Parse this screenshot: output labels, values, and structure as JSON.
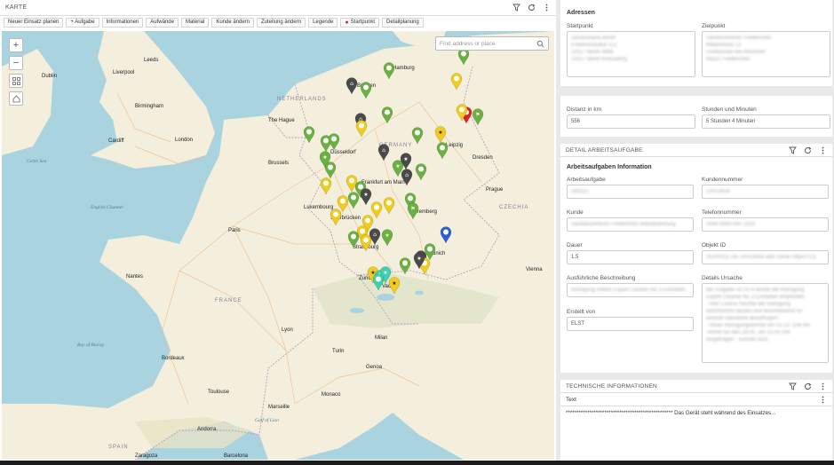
{
  "map_panel": {
    "title": "KARTE",
    "toolbar": [
      "Neuer Einsatz planen",
      "+ Aufgabe",
      "Informationen",
      "Aufwände",
      "Material",
      "Kunde ändern",
      "Zuteilung ändern",
      "Legende",
      "Startpunkt",
      "Detailplanung"
    ],
    "search_placeholder": "Find address or place",
    "cities": [
      "Dublin",
      "Leeds",
      "Liverpool",
      "Birmingham",
      "Cardiff",
      "London",
      "Hamburg",
      "Bremen",
      "The Hague",
      "Düsseldorf",
      "Dresden",
      "Brussels",
      "Frankfurt am Main",
      "Luxembourg",
      "Saarbrücken",
      "Nuremberg",
      "Prague",
      "Paris",
      "Strasbourg",
      "Munich",
      "Vienna",
      "Zurich",
      "Vaduz",
      "Nantes",
      "Lyon",
      "Milan",
      "Turin",
      "Genoa",
      "Bordeaux",
      "Toulouse",
      "Marseille",
      "Monaco",
      "Barcelona",
      "Andorra",
      "Zaragoza",
      "Leipzig"
    ],
    "countries": [
      "NETHERLANDS",
      "GERMANY",
      "CZECHIA",
      "FRANCE",
      "SPAIN"
    ],
    "seas": [
      "Celtic Sea",
      "English Channel",
      "Bay of Biscay",
      "Gulf of Lion"
    ]
  },
  "addresses": {
    "title": "Adressen",
    "start_label": "Startpunkt",
    "start_lines": [
      "Deutschland Berlin",
      "Friedrichstraße 112",
      "10117 Berlin Mitte",
      "10117 Berlin-Kreuzberg"
    ],
    "target_label": "Zielpunkt",
    "target_lines": [
      "Sanitärzentrum Feldkirchen",
      "Mittelstraße 12",
      "Feldkirchen bei München",
      "85622 Feldkirchen"
    ],
    "distance_label": "Distanz in km",
    "distance_value": "556",
    "duration_label": "Stunden und Minuten",
    "duration_value": "5 Stunden 4 Minuten"
  },
  "detail": {
    "header": "DETAIL ARBEITSAUFGABE",
    "title": "Arbeitsaufgaben Information",
    "fields": {
      "task_label": "Arbeitsaufgabe",
      "task_value": "389321",
      "customer_no_label": "Kundennummer",
      "customer_no_value": "10023458",
      "customer_label": "Kunde",
      "customer_value": "Sanitätszentrum Feldkirchen Betriebsleitung",
      "phone_label": "Telefonnummer",
      "phone_value": "0049 8963 000 2333",
      "duration_label": "Dauer",
      "duration_value": "1.5",
      "object_label": "Objekt ID",
      "object_value": "SERVICE-DE-10023458 with Serial Object CS",
      "desc_label": "Ausführliche Beschreibung",
      "desc_value": "Reinigung mittels Expert Cleaner bis 3 Einheiten",
      "reason_label": "Details Ursache",
      "reason_lines": [
        "Bei Aufgabe 327474 wurde die Reinigung",
        "Expert Cleaner bis 3 Einheiten empfohlen.",
        "- Herr Lorenz möchte die Reinigung",
        "durchführen lassen und anschließend für",
        "weitere Standorte beauftragen.",
        "- neuer Reinigungstermin am 02.10. und ein",
        "Termin für den 24.05. um 10.00 Uhr",
        "eingetragen - Einsatz kurz."
      ],
      "created_label": "Erstellt von",
      "created_value": "ELST"
    }
  },
  "tech": {
    "header": "TECHNISCHE INFORMATIONEN",
    "column": "Text",
    "row": "************************************************** Das Gerät steht während des Einsatzes..."
  },
  "colors": {
    "pin_green": "#6bb142",
    "pin_yellow": "#f2cc1c",
    "pin_dark": "#4a4a4a",
    "pin_red": "#e02020",
    "pin_blue": "#2c5fd6",
    "pin_teal": "#3fd0b0"
  }
}
